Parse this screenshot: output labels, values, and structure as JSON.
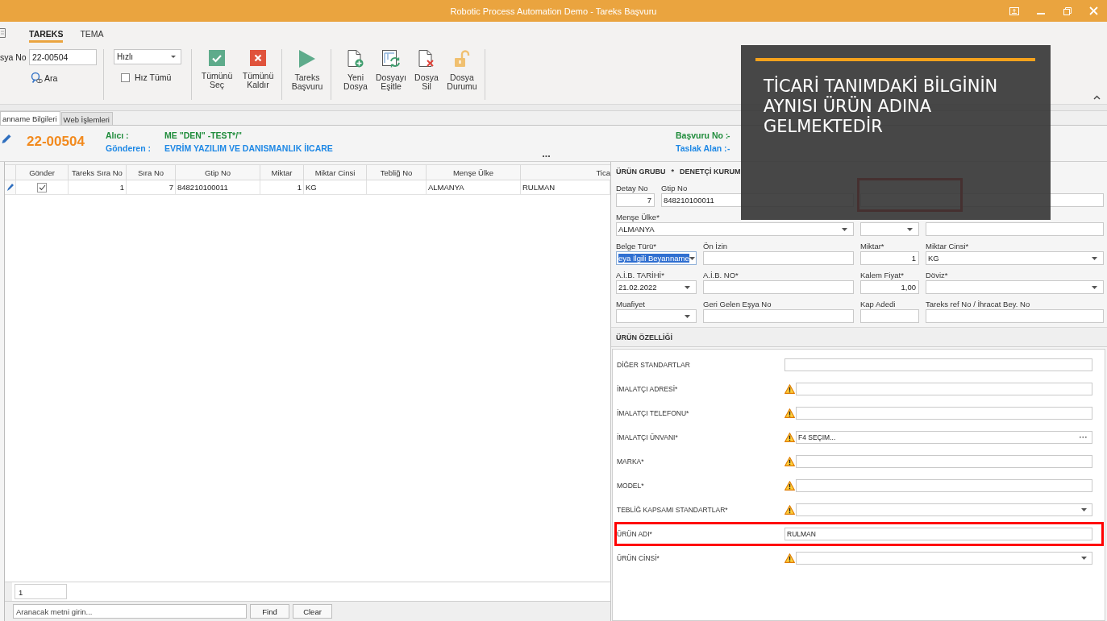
{
  "window": {
    "title": "Robotic Process Automation Demo - Tareks Başvuru"
  },
  "ribbon": {
    "tabs": [
      {
        "label": "TAREKS",
        "selected": true
      },
      {
        "label": "TEMA",
        "selected": false
      }
    ],
    "file_no": {
      "label": "sya No",
      "value": "22-00504"
    },
    "search_button": "Ara",
    "speed": {
      "value": "Hızlı"
    },
    "speed_all": {
      "label": "Hız Tümü",
      "checked": false
    },
    "groups": [
      [
        {
          "kind": "select_all",
          "label": "Tümünü Seç"
        },
        {
          "kind": "deselect_all",
          "label": "Tümünü Kaldır"
        }
      ],
      [
        {
          "kind": "submit",
          "label": "Tareks Başvuru"
        }
      ],
      [
        {
          "kind": "new_file",
          "label": "Yeni Dosya"
        },
        {
          "kind": "sync_file",
          "label": "Dosyayı Eşitle"
        },
        {
          "kind": "delete_file",
          "label": "Dosya Sil"
        },
        {
          "kind": "file_status",
          "label": "Dosya Durumu"
        }
      ]
    ]
  },
  "doc_tabs": [
    {
      "label": "anname Bilgileri",
      "selected": true
    },
    {
      "label": "Web İşlemleri",
      "selected": false
    }
  ],
  "header": {
    "file_number": "22-00504",
    "columns": [
      [
        {
          "label": "Alıcı :",
          "value": "ME \"DEN\" -TEST*/\"",
          "color": "#1f8c3b"
        },
        {
          "label": "Gönderen :",
          "value": "EVRİM YAZILIM VE DANISMANLIK İICARE",
          "color": "#1e88e5"
        }
      ],
      [
        {
          "label": "Başvuru No :",
          "value": "-",
          "color": "#1f8c3b"
        },
        {
          "label": "Taslak Alan :",
          "value": "-",
          "color": "#1e88e5"
        }
      ]
    ]
  },
  "grid": {
    "columns": [
      "Gönder",
      "Tareks Sıra No",
      "Sıra No",
      "Gtip No",
      "Miktar",
      "Miktar Cinsi",
      "Tebliğ No",
      "Menşe Ülke",
      "Tica"
    ],
    "rows": [
      {
        "focused": true,
        "cells": [
          true,
          "1",
          "7",
          "848210100011",
          "1",
          "KG",
          null,
          "ALMANYA",
          "RULMAN"
        ]
      }
    ],
    "row_count": "1",
    "search": {
      "placeholder": "Aranacak metni girin..."
    },
    "buttons": [
      "Find",
      "Clear"
    ]
  },
  "form": {
    "group_title": [
      "ÜRÜN GRUBU",
      "*",
      "DENETÇİ KURUM"
    ],
    "fields": [
      {
        "label": "Detay No",
        "kind": "number",
        "value": "7",
        "highlighted": false,
        "text_selected": false
      },
      {
        "label": "Gtip No",
        "kind": "text",
        "value": "848210100011",
        "highlighted": false,
        "text_selected": false
      },
      {
        "kind": "text",
        "highlighted": true,
        "text_selected": false
      },
      {
        "label": "Menşe Ülke*",
        "kind": "dropdown",
        "value": "ALMANYA",
        "highlighted": false,
        "text_selected": false
      },
      {
        "kind": "dropdown",
        "highlighted": false,
        "text_selected": false
      },
      {
        "kind": "text",
        "highlighted": false,
        "text_selected": false
      },
      {
        "label": "Belge Türü*",
        "kind": "dropdown",
        "value": "eya İlgili Beyanname",
        "highlighted": false,
        "text_selected": true
      },
      {
        "label": "Ön İzin",
        "kind": "text",
        "highlighted": false,
        "text_selected": false
      },
      {
        "label": "Miktar*",
        "kind": "number",
        "value": "1",
        "highlighted": false,
        "text_selected": false
      },
      {
        "label": "Miktar Cinsi*",
        "kind": "dropdown",
        "value": "KG",
        "highlighted": false,
        "text_selected": false
      },
      {
        "label": "A.İ.B. TARİHİ*",
        "kind": "dropdown",
        "value": "21.02.2022",
        "highlighted": false,
        "text_selected": false
      },
      {
        "label": "A.İ.B. NO*",
        "kind": "text",
        "highlighted": false,
        "text_selected": false
      },
      {
        "label": "Kalem Fiyat*",
        "kind": "number",
        "value": "1,00",
        "highlighted": false,
        "text_selected": false
      },
      {
        "label": "Döviz*",
        "kind": "dropdown",
        "highlighted": false,
        "text_selected": false
      },
      {
        "label": "Muafiyet",
        "kind": "dropdown",
        "highlighted": false,
        "text_selected": false
      },
      {
        "label": "Geri Gelen Eşya No",
        "kind": "text",
        "highlighted": false,
        "text_selected": false
      },
      {
        "label": "Kap Adedi",
        "kind": "text",
        "highlighted": false,
        "text_selected": false
      },
      {
        "label": "Tareks ref No / İhracat Bey. No",
        "kind": "text",
        "highlighted": false,
        "text_selected": false
      }
    ]
  },
  "properties": {
    "title": "ÜRÜN ÖZELLİĞİ",
    "items": [
      {
        "label": "DİĞER STANDARTLAR",
        "kind": "text",
        "warning": false,
        "highlighted": false
      },
      {
        "label": "İMALATÇI ADRESİ*",
        "kind": "text",
        "warning": true,
        "highlighted": false
      },
      {
        "label": "İMALATÇI TELEFONU*",
        "kind": "text",
        "warning": true,
        "highlighted": false
      },
      {
        "label": "İMALATÇI ÜNVANI*",
        "kind": "picker",
        "value": "F4 SEÇIM...",
        "warning": true,
        "highlighted": false
      },
      {
        "label": "MARKA*",
        "kind": "text",
        "warning": true,
        "highlighted": false
      },
      {
        "label": "MODEL*",
        "kind": "text",
        "warning": true,
        "highlighted": false
      },
      {
        "label": "TEBLİĞ KAPSAMI STANDARTLAR*",
        "kind": "dropdown",
        "warning": true,
        "highlighted": false
      },
      {
        "label": "ÜRÜN ADI*",
        "kind": "text",
        "value": "RULMAN",
        "warning": false,
        "highlighted": true
      },
      {
        "label": "ÜRÜN CİNSİ*",
        "kind": "dropdown",
        "warning": true,
        "highlighted": false
      }
    ]
  },
  "callout": {
    "text": "TİCARİ TANIMDAKİ BİLGİNİN AYNISI ÜRÜN ADINA GELMEKTEDİR"
  }
}
